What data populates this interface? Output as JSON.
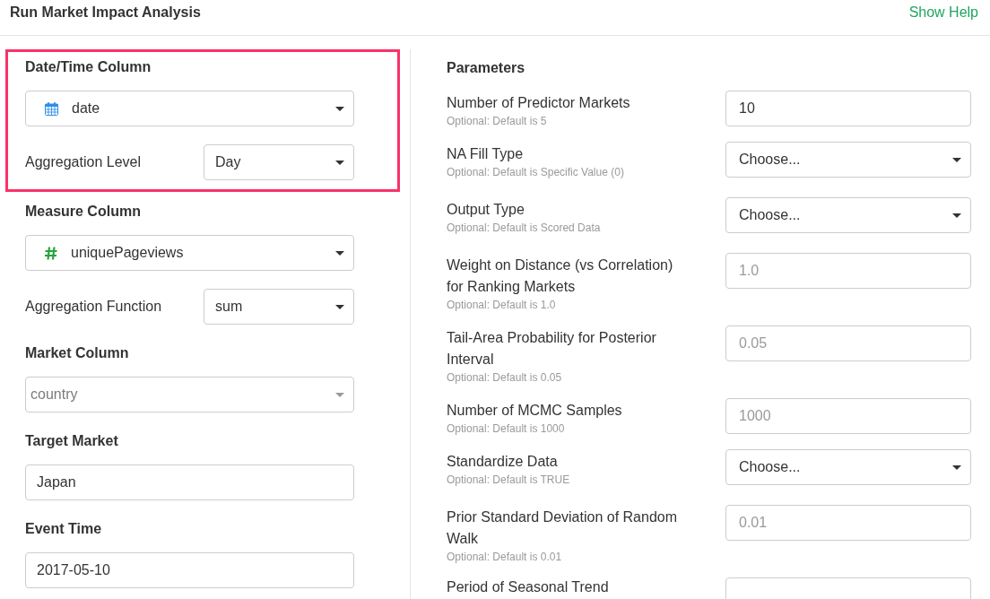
{
  "header": {
    "title": "Run Market Impact Analysis",
    "help_link": "Show Help"
  },
  "left_panel": {
    "highlight_box": {
      "fields": [
        {
          "kind": "date_column_select",
          "heading": "Date/Time Column",
          "value": "date",
          "disabled": false
        },
        {
          "kind": "inline_select",
          "label": "Aggregation Level",
          "value": "Day",
          "disabled": false
        }
      ]
    },
    "fields": [
      {
        "kind": "numeric_column_select",
        "heading": "Measure Column",
        "value": "uniquePageviews",
        "disabled": false
      },
      {
        "kind": "inline_select",
        "label": "Aggregation Function",
        "value": "sum",
        "disabled": false
      },
      {
        "kind": "select",
        "heading": "Market Column",
        "value": "country",
        "disabled": true
      },
      {
        "kind": "input",
        "heading": "Target Market",
        "value": "Japan",
        "disabled": false
      },
      {
        "kind": "input",
        "heading": "Event Time",
        "value": "2017-05-10",
        "disabled": false
      }
    ]
  },
  "parameters": {
    "title": "Parameters",
    "rows": [
      {
        "kind": "input",
        "label": "Number of Predictor Markets",
        "hint": "Optional: Default is 5",
        "value": "10"
      },
      {
        "kind": "select",
        "label": "NA Fill Type",
        "hint": "Optional: Default is Specific Value (0)",
        "value": "Choose..."
      },
      {
        "kind": "select",
        "label": "Output Type",
        "hint": "Optional: Default is Scored Data",
        "value": "Choose..."
      },
      {
        "kind": "input",
        "label": "Weight on Distance (vs Correlation) for Ranking Markets",
        "hint": "Optional: Default is 1.0",
        "placeholder": "1.0"
      },
      {
        "kind": "input",
        "label": "Tail-Area Probability for Posterior Interval",
        "hint": "Optional: Default is 0.05",
        "placeholder": "0.05"
      },
      {
        "kind": "input",
        "label": "Number of MCMC Samples",
        "hint": "Optional: Default is 1000",
        "placeholder": "1000"
      },
      {
        "kind": "select",
        "label": "Standardize Data",
        "hint": "Optional: Default is TRUE",
        "value": "Choose..."
      },
      {
        "kind": "input",
        "label": "Prior Standard Deviation of Random Walk",
        "hint": "Optional: Default is 0.01",
        "placeholder": "0.01"
      },
      {
        "kind": "input",
        "label": "Period of Seasonal Trend"
      }
    ]
  }
}
